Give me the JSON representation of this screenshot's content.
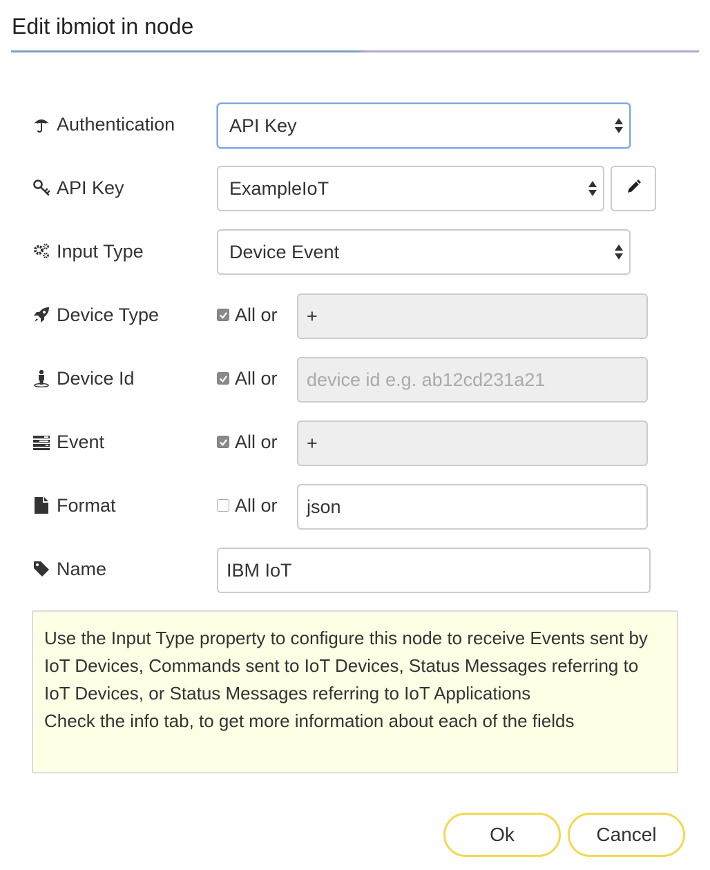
{
  "dialog": {
    "title": "Edit ibmiot in node"
  },
  "fields": {
    "authentication": {
      "label": "Authentication",
      "icon": "umbrella-icon",
      "value": "API Key"
    },
    "api_key": {
      "label": "API Key",
      "icon": "key-icon",
      "value": "ExampleIoT"
    },
    "input_type": {
      "label": "Input Type",
      "icon": "cogs-icon",
      "value": "Device Event"
    },
    "device_type": {
      "label": "Device Type",
      "icon": "rocket-icon",
      "all_label": "All or",
      "all_checked": true,
      "value": "+"
    },
    "device_id": {
      "label": "Device Id",
      "icon": "user-icon",
      "all_label": "All or",
      "all_checked": true,
      "value": "",
      "placeholder": "device id e.g. ab12cd231a21"
    },
    "event": {
      "label": "Event",
      "icon": "tasks-icon",
      "all_label": "All or",
      "all_checked": true,
      "value": "+"
    },
    "format": {
      "label": "Format",
      "icon": "file-icon",
      "all_label": "All or",
      "all_checked": false,
      "value": "json"
    },
    "name": {
      "label": "Name",
      "icon": "tag-icon",
      "value": "IBM IoT"
    }
  },
  "tip": {
    "line1": "Use the Input Type property to configure this node to receive Events sent by IoT Devices, Commands sent to IoT Devices, Status Messages referring to IoT Devices, or Status Messages referring to IoT Applications",
    "line2": "Check the info tab, to get more information about each of the fields"
  },
  "buttons": {
    "ok": "Ok",
    "cancel": "Cancel"
  },
  "colors": {
    "focus": "#85a9e0",
    "button_border": "#f4d84e",
    "tip_background": "#ffffe6"
  }
}
